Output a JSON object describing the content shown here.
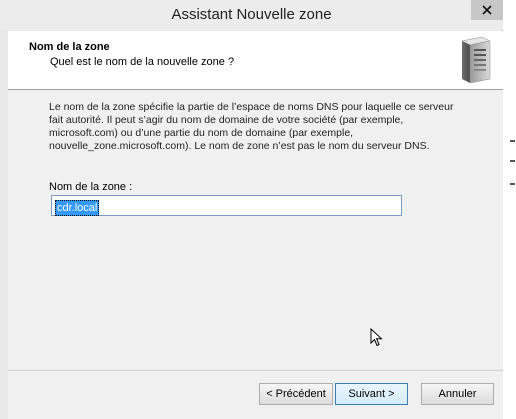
{
  "window": {
    "title": "Assistant Nouvelle zone"
  },
  "header": {
    "title": "Nom de la zone",
    "subtitle": "Quel est le nom de la nouvelle zone ?",
    "icon": "server-icon"
  },
  "main": {
    "description": "Le nom de la zone spécifie la partie de l’espace de noms DNS pour laquelle ce serveur fait autorité. Il peut s’agir du nom de domaine de votre société (par exemple, microsoft.com) ou d’une partie du nom de domaine (par exemple, nouvelle_zone.microsoft.com). Le nom de zone n’est pas le nom du serveur DNS.",
    "zone_name_label": "Nom de la zone :",
    "zone_name_value": "cdr.local"
  },
  "footer": {
    "prev_label": "< Précédent",
    "next_label": "Suivant >",
    "cancel_label": "Annuler"
  },
  "colors": {
    "selection": "#3399ff",
    "close_button": "#c7c7c7"
  }
}
